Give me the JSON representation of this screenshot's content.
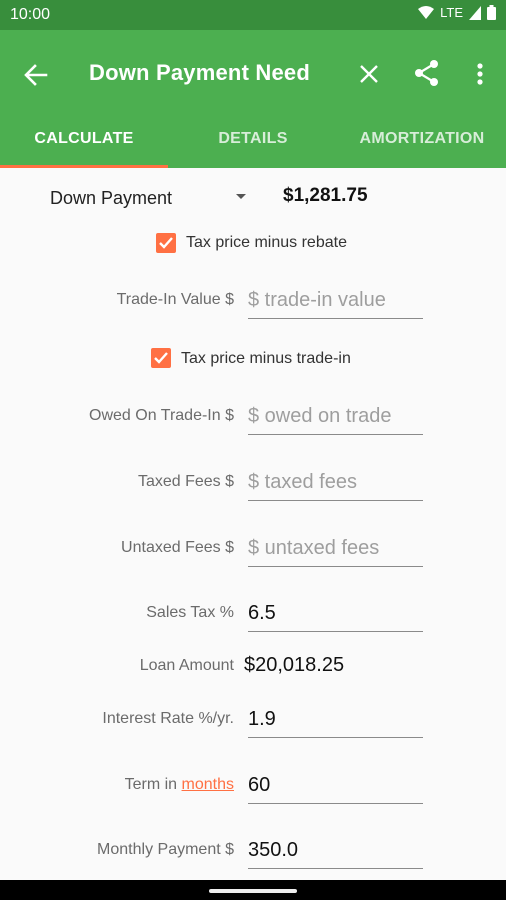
{
  "status_bar": {
    "time": "10:00",
    "network": "LTE"
  },
  "app_bar": {
    "title": "Down Payment Need"
  },
  "tabs": [
    {
      "label": "CALCULATE",
      "active": true
    },
    {
      "label": "DETAILS",
      "active": false
    },
    {
      "label": "AMORTIZATION",
      "active": false
    }
  ],
  "calc": {
    "selector_label": "Down Payment",
    "selector_value": "$1,281.75",
    "tax_rebate_label": "Tax price minus rebate",
    "tax_rebate_checked": true,
    "trade_in_label": "Trade-In Value $",
    "trade_in_placeholder": "$ trade-in value",
    "tax_tradein_label": "Tax price minus trade-in",
    "tax_tradein_checked": true,
    "owed_label": "Owed On Trade-In $",
    "owed_placeholder": "$ owed on trade",
    "taxed_fees_label": "Taxed Fees $",
    "taxed_fees_placeholder": "$ taxed fees",
    "untaxed_fees_label": "Untaxed Fees $",
    "untaxed_fees_placeholder": "$ untaxed fees",
    "sales_tax_label": "Sales Tax %",
    "sales_tax_value": "6.5",
    "loan_amount_label": "Loan Amount",
    "loan_amount_value": "$20,018.25",
    "interest_label": "Interest Rate %/yr.",
    "interest_value": "1.9",
    "term_prefix": "Term in",
    "term_unit_link": "months",
    "term_value": "60",
    "monthly_label": "Monthly Payment $",
    "monthly_value": "350.0"
  },
  "colors": {
    "status_bar": "#388e3c",
    "app_bar": "#4caf50",
    "accent": "#ff7043",
    "background": "#fafafa"
  }
}
